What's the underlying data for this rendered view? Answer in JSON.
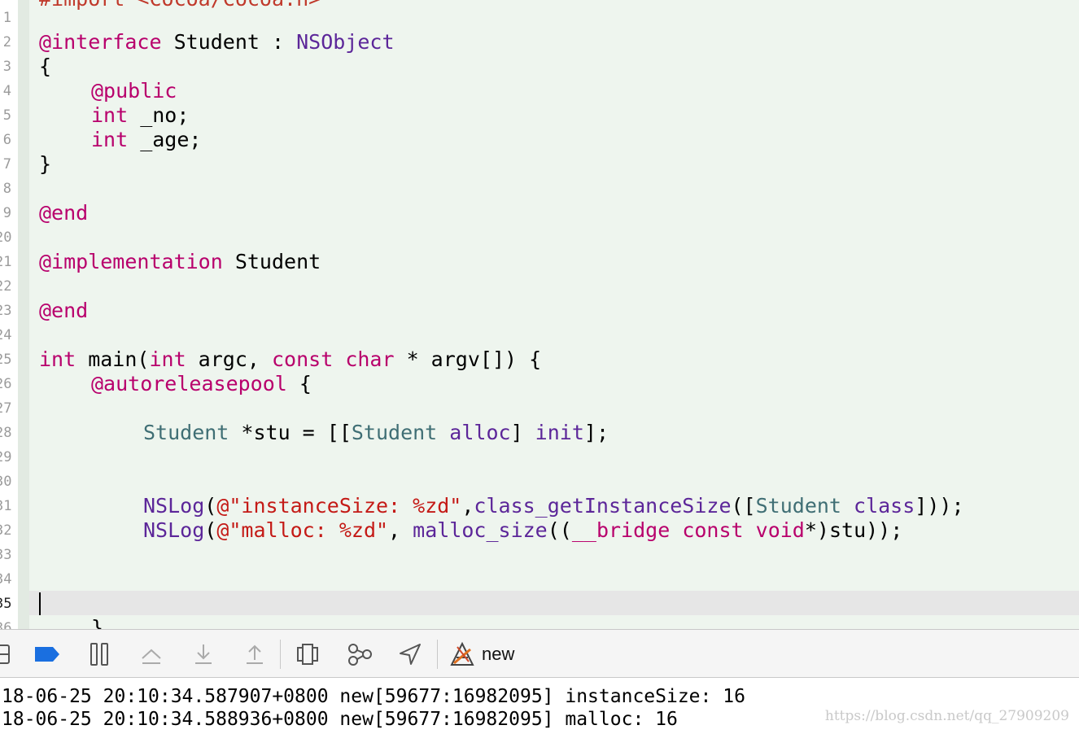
{
  "editor": {
    "top_partial": "#import <Cocoa/Cocoa.h>",
    "line_numbers": [
      "1",
      "2",
      "3",
      "4",
      "5",
      "6",
      "7",
      "8",
      "9",
      "20",
      "21",
      "22",
      "23",
      "24",
      "25",
      "26",
      "27",
      "28",
      "29",
      "30",
      "31",
      "32",
      "33",
      "34",
      "35",
      "36"
    ],
    "lines": {
      "l2": {
        "kw": "@interface",
        "name": " Student : ",
        "super": "NSObject"
      },
      "l3": "{",
      "l4": "@public",
      "l5": {
        "kw": "int",
        "rest": " _no;"
      },
      "l6": {
        "kw": "int",
        "rest": " _age;"
      },
      "l7": "}",
      "l9": "@end",
      "l21": {
        "kw": "@implementation",
        "rest": " Student"
      },
      "l23": "@end",
      "l25": {
        "int1": "int",
        "a": " main(",
        "int2": "int",
        "b": " argc, ",
        "const": "const",
        "c": " ",
        "char": "char",
        "d": " * argv[]) {"
      },
      "l26": {
        "kw": "@autoreleasepool",
        "rest": " {"
      },
      "l28": {
        "cls1": "Student",
        "a": " *stu = [[",
        "cls2": "Student",
        "b": " ",
        "alloc": "alloc",
        "c": "] ",
        "init": "init",
        "d": "];"
      },
      "l31": {
        "fn": "NSLog",
        "a": "(",
        "str": "@\"instanceSize: %zd\"",
        "b": ",",
        "fn2": "class_getInstanceSize",
        "c": "([",
        "cls": "Student",
        "d": " ",
        "class": "class",
        "e": "]));"
      },
      "l32": {
        "fn": "NSLog",
        "a": "(",
        "str": "@\"malloc: %zd\"",
        "b": ", ",
        "fn2": "malloc_size",
        "c": "((",
        "bridge": "__bridge",
        "d": " ",
        "const": "const",
        "e": " ",
        "void": "void",
        "f": "*)stu));"
      },
      "l36": "}"
    }
  },
  "debugbar": {
    "process_name": "new",
    "icons": [
      "console-toggle-icon",
      "breakpoints-icon",
      "pause-icon",
      "step-over-icon",
      "step-into-icon",
      "step-out-icon",
      "view-hierarchy-icon",
      "memory-graph-icon",
      "location-icon",
      "app-icon"
    ]
  },
  "console": {
    "lines": [
      "18-06-25 20:10:34.587907+0800 new[59677:16982095] instanceSize: 16",
      "18-06-25 20:10:34.588936+0800 new[59677:16982095] malloc: 16"
    ]
  },
  "watermark": "https://blog.csdn.net/qq_27909209",
  "colors": {
    "keyword": "#b8006c",
    "type": "#5c2699",
    "project_class": "#3f6e74",
    "string": "#c41a16",
    "breakpoint": "#1a6fe0"
  }
}
